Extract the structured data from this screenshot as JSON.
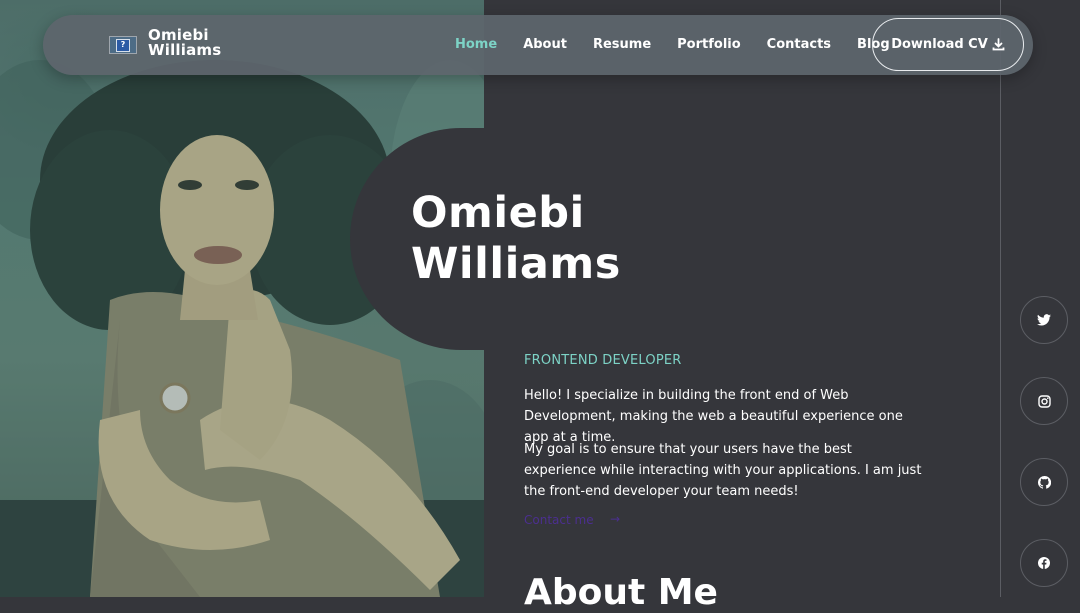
{
  "nav": {
    "brand_line1": "Omiebi",
    "brand_line2": "Williams",
    "links": [
      {
        "label": "Home",
        "active": true
      },
      {
        "label": "About"
      },
      {
        "label": "Resume"
      },
      {
        "label": "Portfolio"
      },
      {
        "label": "Contacts"
      },
      {
        "label": "Blog"
      }
    ],
    "cv_button": "Download CV",
    "cv_icon": "download-icon"
  },
  "hero": {
    "name_line1": "Omiebi",
    "name_line2": "Williams",
    "role": "FRONTEND DEVELOPER",
    "paragraph1": "Hello! I specialize in building the front end of Web Development, making the web a beautiful experience one app at a time.",
    "paragraph2": "My goal is to ensure that your users have the best experience while interacting with your applications. I am just the front-end developer your team needs!",
    "contact_link": "Contact me",
    "contact_arrow": "→"
  },
  "about": {
    "title": "About Me"
  },
  "social": [
    {
      "icon": "twitter-icon"
    },
    {
      "icon": "instagram-icon"
    },
    {
      "icon": "github-icon"
    },
    {
      "icon": "facebook-icon"
    }
  ],
  "colors": {
    "accent": "#7dd3c6",
    "background": "#35363b",
    "navbar": "#5e656d",
    "link_purple": "#4b2f8f"
  }
}
